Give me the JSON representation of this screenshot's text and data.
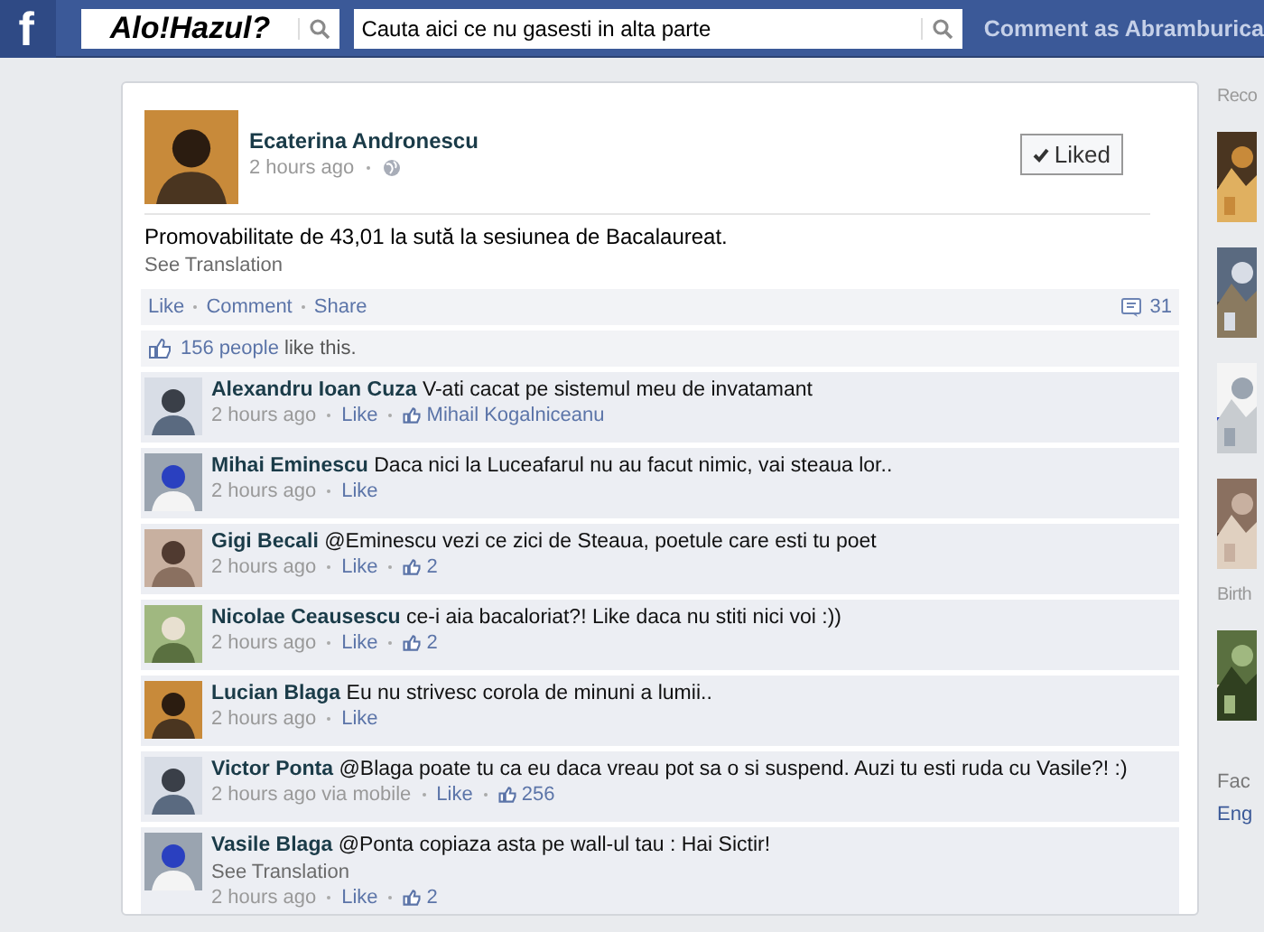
{
  "topbar": {
    "logo": "f",
    "page_name": "Alo!Hazul?",
    "search": {
      "value": "Cauta aici ce nu gasesti in alta parte"
    },
    "comment_as": "Comment as Abramburica"
  },
  "post": {
    "author": "Ecaterina Andronescu",
    "time": "2 hours ago",
    "liked_button": {
      "label": "Liked",
      "selected": true
    },
    "text": "Promovabilitate de 43,01 la sută la sesiunea de Bacalaureat.",
    "see_translation": "See Translation",
    "actions": [
      "Like",
      "Comment",
      "Share"
    ],
    "comment_count": "31",
    "likes_summary": {
      "count": "156 people",
      "rest": "like this."
    }
  },
  "comments": [
    {
      "name": "Alexandru Ioan Cuza",
      "text": "V-ati cacat pe sistemul meu de invatamant",
      "time": "2 hours ago",
      "like": "Like",
      "liked_by": "Mihail Kogalniceanu"
    },
    {
      "name": "Mihai Eminescu",
      "text": "Daca nici la Luceafarul nu au facut nimic, vai steaua lor..",
      "time": "2 hours ago",
      "like": "Like"
    },
    {
      "name": "Gigi Becali",
      "text": "@Eminescu vezi ce zici de Steaua, poetule care esti tu poet",
      "time": "2 hours ago",
      "like": "Like",
      "likes": "2"
    },
    {
      "name": "Nicolae Ceausescu",
      "text": "ce-i aia bacaloriat?! Like daca nu stiti nici voi :))",
      "time": "2 hours ago",
      "like": "Like",
      "likes": "2"
    },
    {
      "name": "Lucian Blaga",
      "text": "Eu nu strivesc corola de minuni a lumii..",
      "time": "2 hours ago",
      "like": "Like"
    },
    {
      "name": "Victor Ponta",
      "text": "@Blaga poate tu ca eu daca vreau pot sa o si suspend. Auzi tu esti ruda cu Vasile?! :)",
      "time": "2 hours ago",
      "via": "via mobile",
      "like": "Like",
      "likes": "256"
    },
    {
      "name": "Vasile Blaga",
      "text": "@Ponta copiaza asta pe wall-ul tau : Hai Sictir!",
      "see_translation": "See Translation",
      "time": "2 hours ago",
      "like": "Like",
      "likes": "2"
    }
  ],
  "sidebar": {
    "items": [
      {
        "kind": "heading",
        "text": "Reco"
      },
      {
        "kind": "picture"
      },
      {
        "kind": "picture"
      },
      {
        "kind": "picture"
      },
      {
        "kind": "picture"
      },
      {
        "kind": "heading",
        "text": "Birth"
      },
      {
        "kind": "picture"
      },
      {
        "kind": "footer",
        "text": "Fac"
      },
      {
        "kind": "link",
        "text": "Eng"
      }
    ]
  }
}
